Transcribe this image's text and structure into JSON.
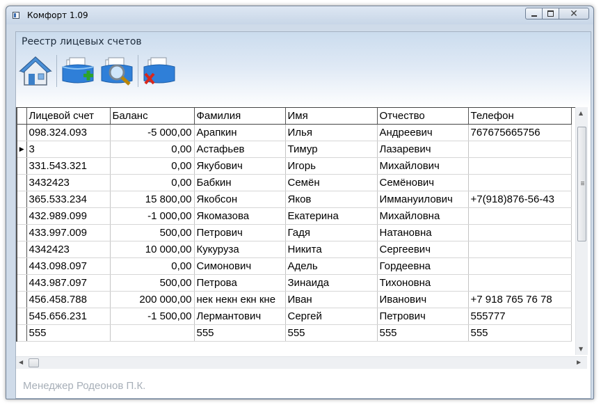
{
  "window": {
    "title": "Комфорт 1.09",
    "minimize_icon": "minimize-icon",
    "maximize_icon": "maximize-icon",
    "close_icon": "close-icon"
  },
  "page": {
    "title": "Реестр лицевых счетов"
  },
  "toolbar": {
    "items": [
      {
        "icon": "home-icon"
      },
      {
        "icon": "add-account-icon"
      },
      {
        "icon": "search-account-icon"
      },
      {
        "icon": "delete-account-icon"
      }
    ]
  },
  "grid": {
    "columns": [
      "Лицевой счет",
      "Баланс",
      "Фамилия",
      "Имя",
      "Отчество",
      "Телефон"
    ],
    "current_row_index": 1,
    "rows": [
      [
        "098.324.093",
        "-5 000,00",
        "Арапкин",
        "Илья",
        "Андреевич",
        "767675665756"
      ],
      [
        "3",
        "0,00",
        "Астафьев",
        "Тимур",
        "Лазаревич",
        ""
      ],
      [
        "331.543.321",
        "0,00",
        "Якубович",
        "Игорь",
        "Михайлович",
        ""
      ],
      [
        "3432423",
        "0,00",
        "Бабкин",
        "Семён",
        "Семёнович",
        ""
      ],
      [
        "365.533.234",
        "15 800,00",
        "Якобсон",
        "Яков",
        "Иммануилович",
        "+7(918)876-56-43"
      ],
      [
        "432.989.099",
        "-1 000,00",
        "Якомазова",
        "Екатерина",
        "Михайловна",
        ""
      ],
      [
        "433.997.009",
        "500,00",
        "Петрович",
        "Гадя",
        "Натановна",
        ""
      ],
      [
        "4342423",
        "10 000,00",
        "Кукуруза",
        "Никита",
        "Сергеевич",
        ""
      ],
      [
        "443.098.097",
        "0,00",
        "Симонович",
        "Адель",
        "Гордеевна",
        ""
      ],
      [
        "443.987.097",
        "500,00",
        "Петрова",
        "Зинаида",
        "Тихоновна",
        ""
      ],
      [
        "456.458.788",
        "200 000,00",
        "нек некн екн кне",
        "Иван",
        "Иванович",
        "+7 918 765 76 78"
      ],
      [
        "545.656.231",
        "-1 500,00",
        "Лермантович",
        "Сергей",
        "Петрович",
        "555777"
      ],
      [
        "555",
        "",
        "555",
        "555",
        "555",
        "555"
      ]
    ]
  },
  "status": {
    "text": "Менеджер  Родеонов П.К."
  },
  "colors": {
    "header_gradient_top": "#cbdcee",
    "window_frame": "#cfdbe9"
  }
}
